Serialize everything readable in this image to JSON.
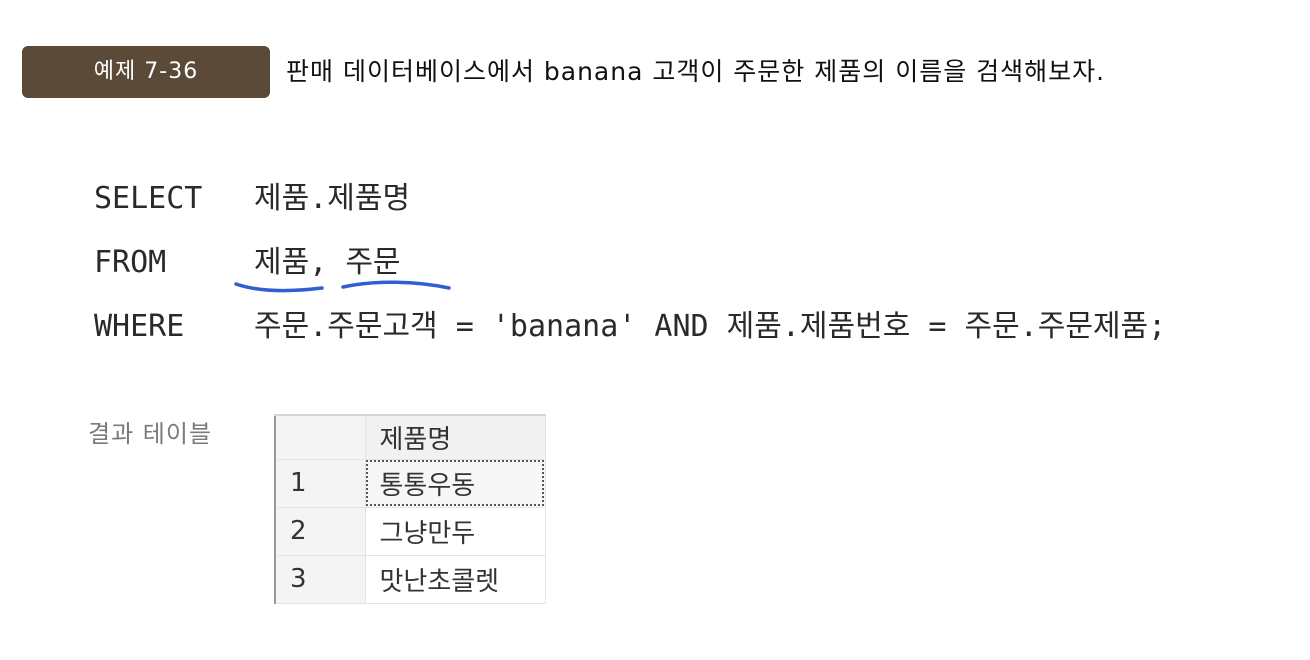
{
  "example": {
    "badge": "예제 7-36",
    "title": "판매 데이터베이스에서 banana 고객이 주문한 제품의 이름을 검색해보자."
  },
  "sql": {
    "select_kw": "SELECT",
    "select_expr": "제품.제품명",
    "from_kw": "FROM",
    "from_table1": "제품",
    "from_sep": ", ",
    "from_table2": "주문",
    "where_kw": "WHERE",
    "where_expr": "주문.주문고객 = 'banana'  AND  제품.제품번호 = 주문.주문제품;"
  },
  "annotation_color": "#2f5fd0",
  "result": {
    "label": "결과 테이블",
    "header": [
      "",
      "제품명"
    ],
    "rows": [
      {
        "index": "1",
        "value": "통통우동"
      },
      {
        "index": "2",
        "value": "그냥만두"
      },
      {
        "index": "3",
        "value": "맛난초콜렛"
      }
    ]
  }
}
